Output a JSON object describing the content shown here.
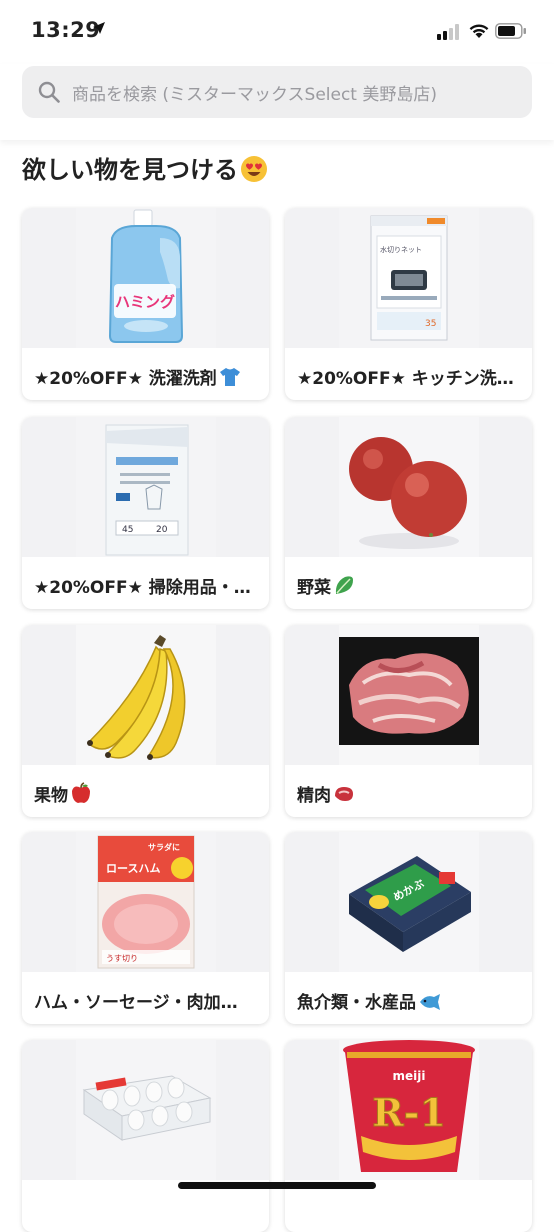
{
  "status_bar": {
    "time": "13:29"
  },
  "search": {
    "placeholder": "商品を検索 (ミスターマックスSelect 美野島店)"
  },
  "section": {
    "title": "欲しい物を見つける"
  },
  "categories": [
    {
      "label": "★20%OFF★ 洗濯洗剤"
    },
    {
      "label": "★20%OFF★ キッチン洗…"
    },
    {
      "label": "★20%OFF★ 掃除用品・…"
    },
    {
      "label": "野菜"
    },
    {
      "label": "果物"
    },
    {
      "label": "精肉"
    },
    {
      "label": "ハム・ソーセージ・肉加…"
    },
    {
      "label": "魚介類・水産品"
    },
    {
      "label": ""
    },
    {
      "label": ""
    }
  ],
  "product_images": {
    "card1": {
      "band_text": "ハミング"
    },
    "card2": {
      "line1": "水切りネット",
      "line2": "35"
    },
    "card3": {
      "line1": "45",
      "line2": "20"
    },
    "card7": {
      "line1": "サラダに",
      "line2": "ロースハム",
      "line3": "うす切り"
    },
    "card8": {
      "line1": "めかぶ"
    },
    "card10": {
      "brand": "meiji",
      "line1": "R-1"
    }
  }
}
